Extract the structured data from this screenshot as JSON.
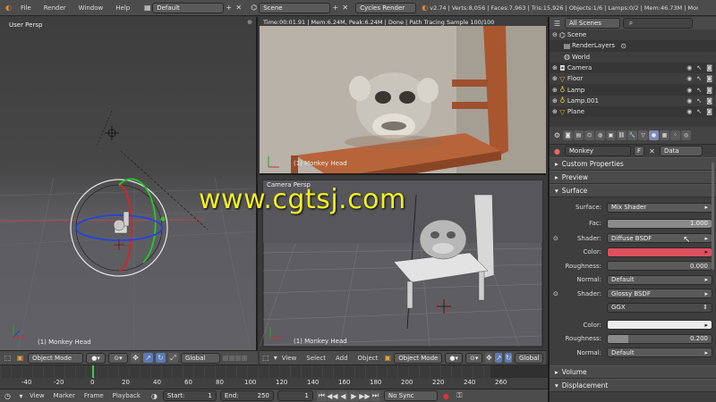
{
  "topbar": {
    "menus": [
      "File",
      "Render",
      "Window",
      "Help"
    ],
    "layout": "Default",
    "scene": "Scene",
    "engine": "Cycles Render",
    "stats": "v2.74 | Verts:8,056 | Faces:7,963 | Tris:15,926 | Objects:1/6 | Lamps:0/2 | Mem:46.73M | Monk"
  },
  "viewport_left": {
    "label": "User Persp",
    "object_label": "(1) Monkey Head",
    "mode": "Object Mode",
    "orientation": "Global"
  },
  "render_view": {
    "info": "Time:00:01.91 | Mem:6.24M, Peak:6.24M | Done | Path Tracing Sample 100/100",
    "object_label": "(1) Monkey Head"
  },
  "camera_view": {
    "label": "Camera Persp",
    "object_label": "(1) Monkey Head",
    "menus": [
      "View",
      "Select",
      "Add",
      "Object"
    ],
    "mode": "Object Mode",
    "orientation": "Global"
  },
  "watermark": "www.cgtsj.com",
  "outliner": {
    "filter": "All Scenes",
    "rows": [
      "Scene",
      "RenderLayers",
      "World",
      "Camera",
      "Floor",
      "Lamp",
      "Lamp.001",
      "Plane"
    ]
  },
  "properties": {
    "object": "Monkey",
    "f_label": "F",
    "data_select": "Data",
    "panels": {
      "custom_properties": "Custom Properties",
      "preview": "Preview",
      "surface": "Surface",
      "volume": "Volume",
      "displacement": "Displacement"
    },
    "rows": {
      "surface_label": "Surface:",
      "surface_value": "Mix Shader",
      "fac_label": "Fac:",
      "fac_value": "1.000",
      "fac": 1.0,
      "shader1_label": "Shader:",
      "shader1_value": "Diffuse BSDF",
      "color1_label": "Color:",
      "color1": "#e0505e",
      "roughness1_label": "Roughness:",
      "roughness1_value": "0.000",
      "roughness1": 0.0,
      "normal1_label": "Normal:",
      "normal1_value": "Default",
      "shader2_label": "Shader:",
      "shader2_value": "Glossy BSDF",
      "distribution_value": "GGX",
      "color2_label": "Color:",
      "color2": "#ebebeb",
      "roughness2_label": "Roughness:",
      "roughness2_value": "0.200",
      "roughness2": 0.2,
      "normal2_label": "Normal:",
      "normal2_value": "Default"
    }
  },
  "timeline": {
    "ticks": [
      "-40",
      "-20",
      "0",
      "20",
      "40",
      "60",
      "80",
      "100",
      "120",
      "140",
      "160",
      "180",
      "200",
      "220",
      "240",
      "260"
    ],
    "menus": [
      "View",
      "Marker",
      "Frame",
      "Playback"
    ],
    "start_label": "Start:",
    "start_value": "1",
    "end_label": "End:",
    "end_value": "250",
    "current_frame": "1",
    "sync": "No Sync"
  },
  "colors": {
    "accent": "#7d8ab5",
    "playhead": "#3ecf3e",
    "watermark": "#f3f01e"
  }
}
